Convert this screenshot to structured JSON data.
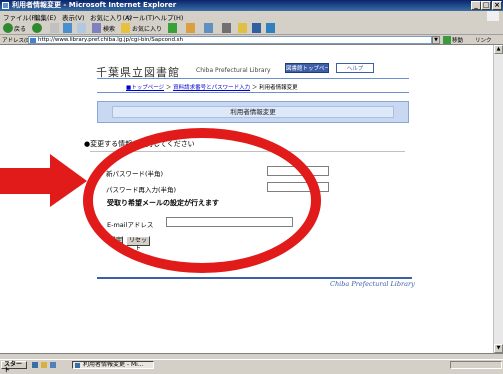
{
  "window": {
    "title": "利用者情報変更 - Microsoft Internet Explorer"
  },
  "menu": [
    "ファイル(F)",
    "編集(E)",
    "表示(V)",
    "お気に入り(A)",
    "ツール(T)",
    "ヘルプ(H)"
  ],
  "toolbar": {
    "back": "戻る",
    "search": "検索",
    "favorites": "お気に入り"
  },
  "address": {
    "label": "アドレス(D)",
    "url": "http://www.library.pref.chiba.lg.jp/cgi-bin/Sapcond.sh",
    "go": "移動",
    "links": "リンク"
  },
  "page": {
    "lib_title": "千葉県立図書館",
    "lib_subtitle": "Chiba Prefectural Library",
    "btn_blue": "図書館トップページ",
    "btn_white": "ヘルプ",
    "breadcrumb": {
      "link1": "■トップページ",
      "sep": "＞",
      "link2": "資料請求番号とパスワード入力",
      "current": "利用者情報変更"
    },
    "section_title": "利用者情報変更",
    "instruction": "●変更する情報を入力してください",
    "new_password_label": "新パスワード(半角)",
    "new_password_value": "",
    "confirm_password_label": "パスワード再入力(半角)",
    "confirm_password_value": "",
    "mail_heading": "受取り希望メールの設定が行えます",
    "email_label": "E-mailアドレス",
    "email_value": "",
    "submit_label": "設定",
    "reset_label": "リセット",
    "footer": "Chiba Prefectural Library"
  },
  "taskbar": {
    "start": "スタート",
    "task": "利用者情報変更 - Mi..."
  },
  "colors": {
    "annotation_arrow": "#e11a1a",
    "annotation_circle": "#e11a1a",
    "brand_blue": "#3d5fa8"
  }
}
